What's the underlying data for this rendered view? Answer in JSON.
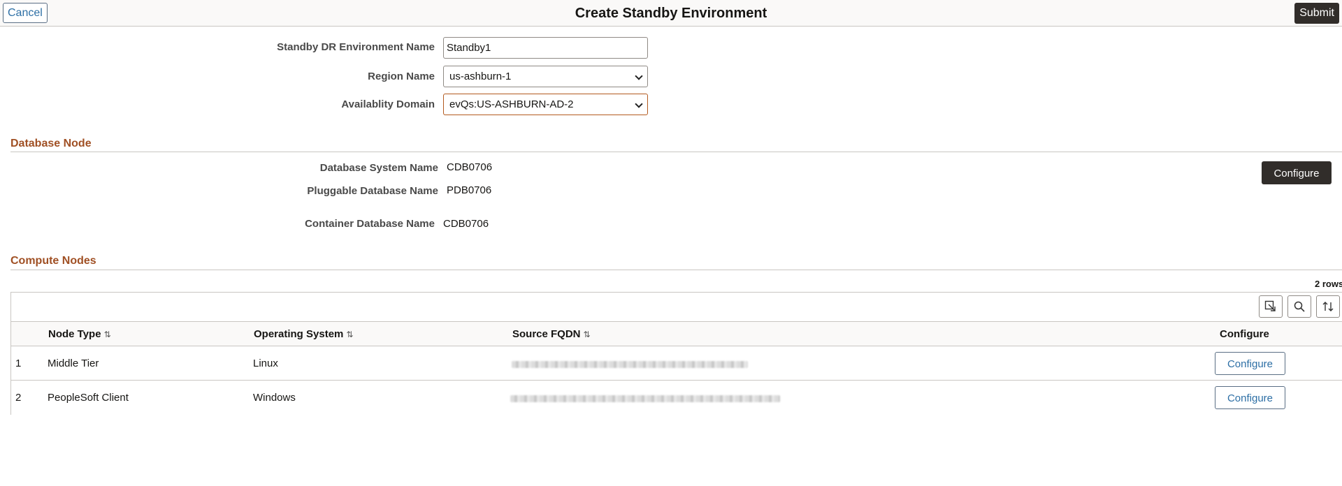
{
  "header": {
    "cancel_label": "Cancel",
    "title": "Create Standby Environment",
    "submit_label": "Submit"
  },
  "form": {
    "env_name": {
      "label": "Standby DR Environment Name",
      "value": "Standby1"
    },
    "region": {
      "label": "Region Name",
      "value": "us-ashburn-1"
    },
    "availability_domain": {
      "label": "Availablity Domain",
      "value": "evQs:US-ASHBURN-AD-2"
    }
  },
  "database_node": {
    "title": "Database Node",
    "system_name": {
      "label": "Database System Name",
      "value": "CDB0706"
    },
    "pluggable_name": {
      "label": "Pluggable Database Name",
      "value": "PDB0706"
    },
    "container_name": {
      "label": "Container Database Name",
      "value": "CDB0706"
    },
    "configure_label": "Configure"
  },
  "compute_nodes": {
    "title": "Compute Nodes",
    "rows_count": "2 rows",
    "toolbar": {
      "icons": [
        "export-icon",
        "search-icon",
        "sort-icon"
      ]
    },
    "columns": [
      {
        "label": "Node Type",
        "sortable": true
      },
      {
        "label": "Operating System",
        "sortable": true
      },
      {
        "label": "Source FQDN",
        "sortable": true
      },
      {
        "label": "Configure",
        "sortable": false
      }
    ],
    "sort_glyph": "⇅",
    "rows": [
      {
        "num": "1",
        "node_type": "Middle Tier",
        "os": "Linux",
        "fqdn_redacted": true,
        "configure_label": "Configure"
      },
      {
        "num": "2",
        "node_type": "PeopleSoft Client",
        "os": "Windows",
        "fqdn_redacted": true,
        "configure_label": "Configure"
      }
    ]
  }
}
